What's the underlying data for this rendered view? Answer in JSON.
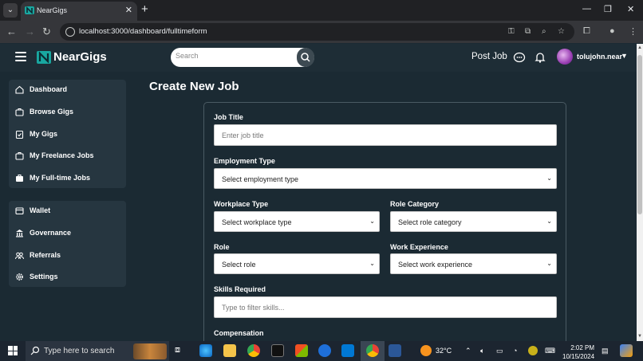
{
  "browser": {
    "tab_title": "NearGigs",
    "url": "localhost:3000/dashboard/fulltimeform"
  },
  "header": {
    "brand": "NearGigs",
    "search_placeholder": "Search",
    "post_job": "Post Job",
    "username": "tolujohn.near"
  },
  "sidebar": {
    "group1": [
      {
        "label": "Dashboard",
        "icon": "home-icon"
      },
      {
        "label": "Browse Gigs",
        "icon": "briefcase-icon"
      },
      {
        "label": "My Gigs",
        "icon": "clipboard-icon"
      },
      {
        "label": "My Freelance Jobs",
        "icon": "briefcase-icon"
      },
      {
        "label": "My Full-time Jobs",
        "icon": "briefcase-filled-icon"
      }
    ],
    "group2": [
      {
        "label": "Wallet",
        "icon": "wallet-icon"
      },
      {
        "label": "Governance",
        "icon": "bank-icon"
      },
      {
        "label": "Referrals",
        "icon": "users-icon"
      },
      {
        "label": "Settings",
        "icon": "gear-icon"
      }
    ]
  },
  "main": {
    "title": "Create New Job",
    "form": {
      "job_title_label": "Job Title",
      "job_title_placeholder": "Enter job title",
      "employment_type_label": "Employment Type",
      "employment_type_value": "Select employment type",
      "workplace_type_label": "Workplace Type",
      "workplace_type_value": "Select workplace type",
      "role_category_label": "Role Category",
      "role_category_value": "Select role category",
      "role_label": "Role",
      "role_value": "Select role",
      "work_experience_label": "Work Experience",
      "work_experience_value": "Select work experience",
      "skills_label": "Skills Required",
      "skills_placeholder": "Type to filter skills...",
      "compensation_label": "Compensation"
    }
  },
  "taskbar": {
    "search_text": "Type here to search",
    "temperature": "32°C",
    "time": "2:02 PM",
    "date": "10/15/2024"
  },
  "colors": {
    "page_bg": "#1b2a33",
    "sidebar_card": "#263640",
    "brand_icon": "#19a7a0"
  }
}
